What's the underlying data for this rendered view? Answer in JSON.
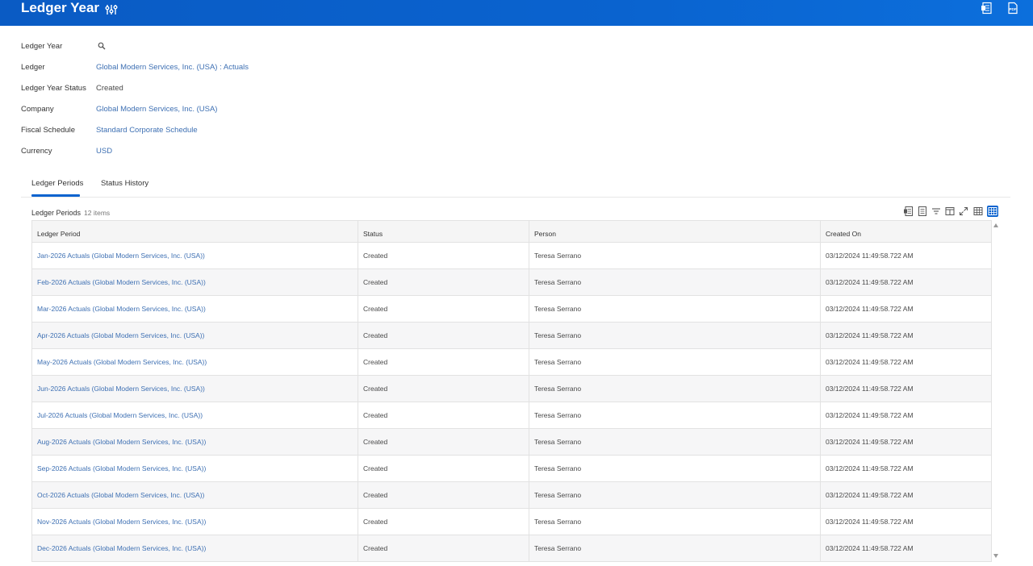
{
  "header": {
    "title": "Ledger Year",
    "related_icon": "related-actions-sliders-icon",
    "excel_icon": "export-to-excel-icon",
    "pdf_icon": "export-to-pdf-icon",
    "pdf_text": "PDF",
    "color": "#0a63cf"
  },
  "fields": {
    "ledger_year": {
      "label": "Ledger Year",
      "value": ""
    },
    "ledger": {
      "label": "Ledger",
      "value": "Global Modern Services, Inc. (USA) : Actuals"
    },
    "ledger_year_status": {
      "label": "Ledger Year Status",
      "value": "Created"
    },
    "company": {
      "label": "Company",
      "value": "Global Modern Services, Inc. (USA)"
    },
    "fiscal_schedule": {
      "label": "Fiscal Schedule",
      "value": "Standard Corporate Schedule"
    },
    "currency": {
      "label": "Currency",
      "value": "USD"
    }
  },
  "tabs": [
    {
      "label": "Ledger Periods",
      "active": true
    },
    {
      "label": "Status History",
      "active": false
    }
  ],
  "grid": {
    "title": "Ledger Periods",
    "count": "12 items",
    "toolbar_icons": [
      "export-to-excel-icon",
      "export-to-worksheets-icon",
      "filter-icon",
      "column-chooser-icon",
      "fullscreen-icon",
      "table-view-icon",
      "grid-view-icon"
    ],
    "columns": [
      "Ledger Period",
      "Status",
      "Person",
      "Created On"
    ],
    "rows": [
      [
        "Jan-2026 Actuals (Global Modern Services, Inc. (USA))",
        "Created",
        "Teresa Serrano",
        "03/12/2024 11:49:58.722 AM"
      ],
      [
        "Feb-2026 Actuals (Global Modern Services, Inc. (USA))",
        "Created",
        "Teresa Serrano",
        "03/12/2024 11:49:58.722 AM"
      ],
      [
        "Mar-2026 Actuals (Global Modern Services, Inc. (USA))",
        "Created",
        "Teresa Serrano",
        "03/12/2024 11:49:58.722 AM"
      ],
      [
        "Apr-2026 Actuals (Global Modern Services, Inc. (USA))",
        "Created",
        "Teresa Serrano",
        "03/12/2024 11:49:58.722 AM"
      ],
      [
        "May-2026 Actuals (Global Modern Services, Inc. (USA))",
        "Created",
        "Teresa Serrano",
        "03/12/2024 11:49:58.722 AM"
      ],
      [
        "Jun-2026 Actuals (Global Modern Services, Inc. (USA))",
        "Created",
        "Teresa Serrano",
        "03/12/2024 11:49:58.722 AM"
      ],
      [
        "Jul-2026 Actuals (Global Modern Services, Inc. (USA))",
        "Created",
        "Teresa Serrano",
        "03/12/2024 11:49:58.722 AM"
      ],
      [
        "Aug-2026 Actuals (Global Modern Services, Inc. (USA))",
        "Created",
        "Teresa Serrano",
        "03/12/2024 11:49:58.722 AM"
      ],
      [
        "Sep-2026 Actuals (Global Modern Services, Inc. (USA))",
        "Created",
        "Teresa Serrano",
        "03/12/2024 11:49:58.722 AM"
      ],
      [
        "Oct-2026 Actuals (Global Modern Services, Inc. (USA))",
        "Created",
        "Teresa Serrano",
        "03/12/2024 11:49:58.722 AM"
      ],
      [
        "Nov-2026 Actuals (Global Modern Services, Inc. (USA))",
        "Created",
        "Teresa Serrano",
        "03/12/2024 11:49:58.722 AM"
      ],
      [
        "Dec-2026 Actuals (Global Modern Services, Inc. (USA))",
        "Created",
        "Teresa Serrano",
        "03/12/2024 11:49:58.722 AM"
      ]
    ]
  }
}
